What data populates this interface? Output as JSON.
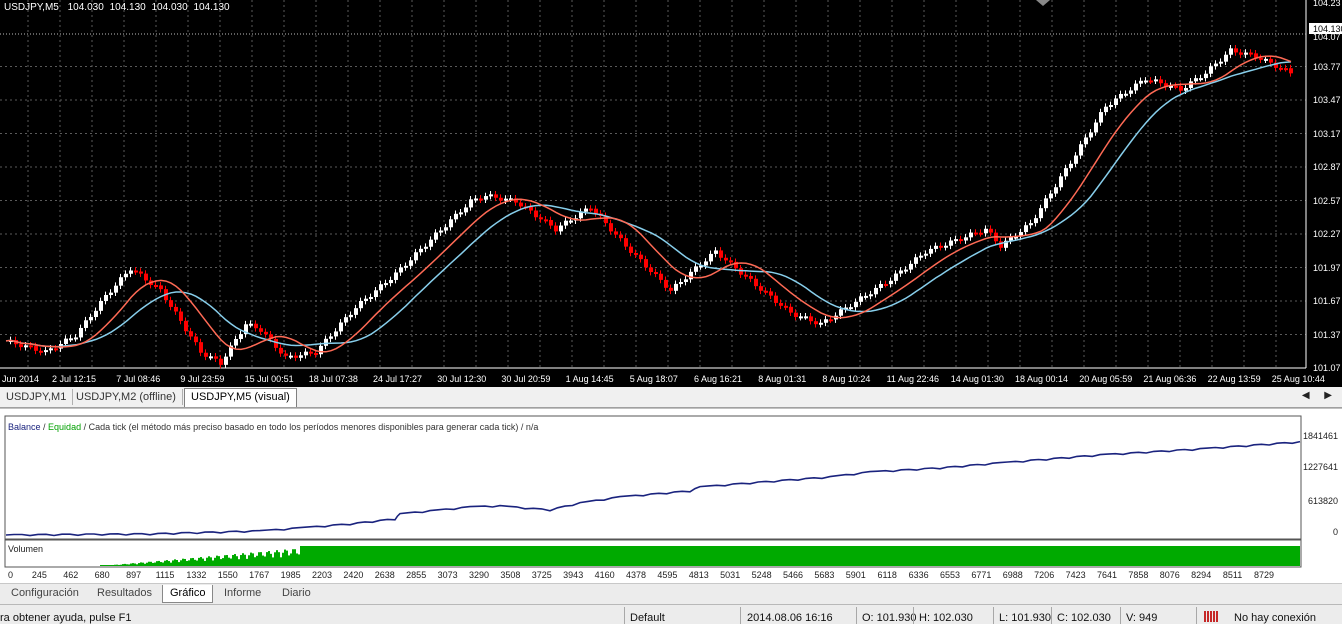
{
  "chart": {
    "symbol": "USDJPY,M5",
    "ohlc": [
      "104.030",
      "104.130",
      "104.030",
      "104.130"
    ],
    "current_price": "104.130",
    "price_labels": [
      "104.23",
      "104.13",
      "104.07",
      "103.77",
      "103.47",
      "103.17",
      "102.87",
      "102.57",
      "102.27",
      "101.97",
      "101.67",
      "101.37",
      "101.07"
    ],
    "time_labels": [
      "Jun 2014",
      "2 Jul 12:15",
      "7 Jul 08:46",
      "9 Jul 23:59",
      "15 Jul 00:51",
      "18 Jul 07:38",
      "24 Jul 17:27",
      "30 Jul 12:30",
      "30 Jul 20:59",
      "1 Aug 14:45",
      "5 Aug 18:07",
      "6 Aug 16:21",
      "8 Aug 01:31",
      "8 Aug 10:24",
      "11 Aug 22:46",
      "14 Aug 01:30",
      "18 Aug 00:14",
      "20 Aug 05:59",
      "21 Aug 06:36",
      "22 Aug 13:59",
      "25 Aug 10:44"
    ],
    "colors": {
      "bull_candle": "#ffffff",
      "bear_candle": "#ff0000",
      "fast_ma": "#ff6a55",
      "slow_ma": "#87ceeb",
      "grid": "#5a5a5a",
      "background": "#000000"
    }
  },
  "chart_tabs": [
    "USDJPY,M1",
    "USDJPY,M2 (offline)",
    "USDJPY,M5 (visual)"
  ],
  "tab_arrows": "◀ ▶",
  "tester": {
    "legend": {
      "balance": "Balance",
      "sep1": " / ",
      "equity": "Equidad",
      "description": " / Cada tick (el método más preciso basado en todo los períodos menores disponibles para generar cada tick)  / n/a"
    },
    "balance_axis": [
      "1841461",
      "1227641",
      "613820",
      "0"
    ],
    "volume_label": "Volumen",
    "x_axis": [
      "0",
      "245",
      "462",
      "680",
      "897",
      "1115",
      "1332",
      "1550",
      "1767",
      "1985",
      "2203",
      "2420",
      "2638",
      "2855",
      "3073",
      "3290",
      "3508",
      "3725",
      "3943",
      "4160",
      "4378",
      "4595",
      "4813",
      "5031",
      "5248",
      "5466",
      "5683",
      "5901",
      "6118",
      "6336",
      "6553",
      "6771",
      "6988",
      "7206",
      "7423",
      "7641",
      "7858",
      "8076",
      "8294",
      "8511",
      "8729"
    ],
    "colors": {
      "balance_line": "#1a237e",
      "volume": "#00aa00"
    }
  },
  "bottom_tabs": [
    "Configuración",
    "Resultados",
    "Gráfico",
    "Informe",
    "Diario"
  ],
  "active_bottom_tab": "Gráfico",
  "status": {
    "help": "ra obtener ayuda, pulse F1",
    "profile": "Default",
    "datetime": "2014.08.06 16:16",
    "open": "O: 101.930",
    "high": "H: 102.030",
    "low": "L: 101.930",
    "close": "C: 102.030",
    "volume": "V: 949",
    "connection": "No hay conexión"
  }
}
